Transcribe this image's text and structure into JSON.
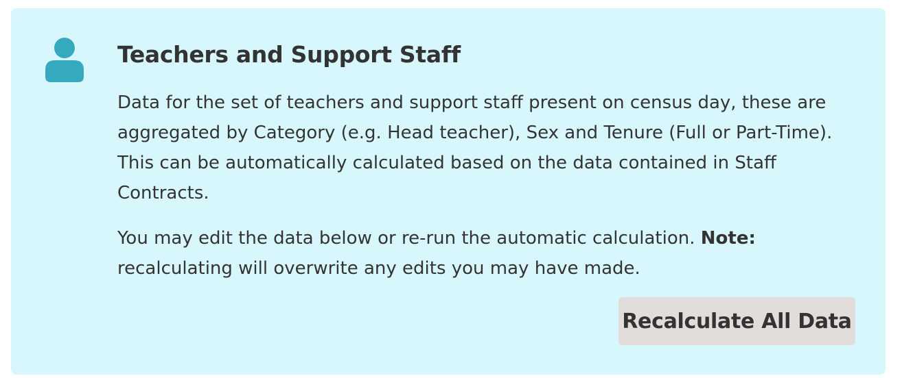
{
  "panel": {
    "icon": "user-icon",
    "title": "Teachers and Support Staff",
    "description_lines": [
      "Data for the set of teachers and support staff present on census day, these are",
      "aggregated by Category (e.g. Head teacher), Sex and Tenure (Full or Part-Time).",
      "This can be automatically calculated based on the data contained in Staff",
      "Contracts."
    ],
    "note_lines": {
      "line1_prefix": "You may edit the data below or re-run the automatic calculation. ",
      "note_label": "Note:",
      "line2": "recalculating will overwrite any edits you may have made."
    },
    "button_label": "Recalculate All Data"
  },
  "colors": {
    "panel_bg": "#d8f7fd",
    "icon": "#35aabf",
    "button_bg": "#e2dcdb",
    "text": "#333333"
  }
}
